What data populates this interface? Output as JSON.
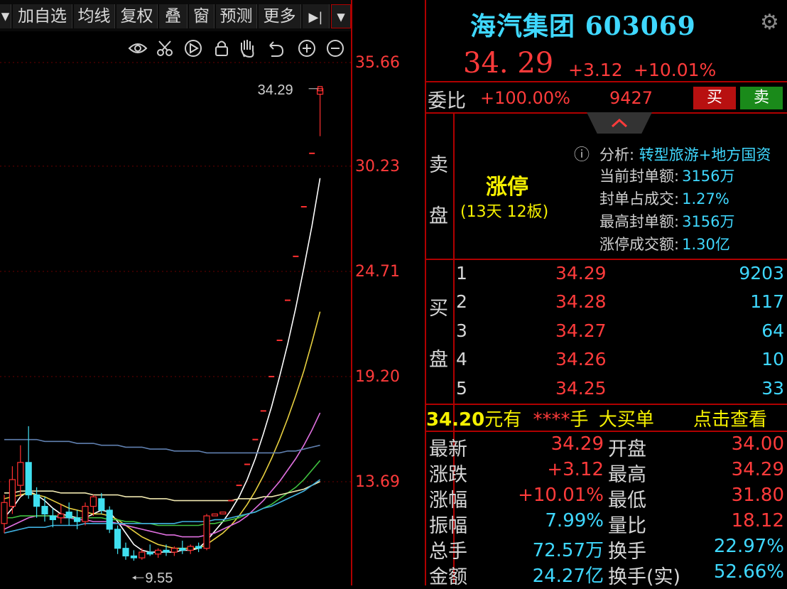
{
  "toolbar": {
    "items": [
      "加自选",
      "均线",
      "复权",
      "叠",
      "窗",
      "预测",
      "更多"
    ],
    "dropdown_arrow": "▾",
    "play_icon": "▶|"
  },
  "chart_tools": [
    "eye-icon",
    "scissors-icon",
    "play-icon",
    "lock-icon",
    "hand-icon",
    "undo-icon",
    "zoom-in-icon",
    "zoom-out-icon"
  ],
  "chart_data": {
    "type": "candlestick",
    "y_ticks": [
      "35.66",
      "30.23",
      "24.71",
      "19.20",
      "13.69"
    ],
    "ylim": [
      9.0,
      37.0
    ],
    "last_price_label": "34.29",
    "low_marker_label": "9.55",
    "candles": [
      {
        "o": 11.5,
        "h": 13.0,
        "l": 11.0,
        "c": 12.6
      },
      {
        "o": 12.4,
        "h": 14.5,
        "l": 12.0,
        "c": 13.8
      },
      {
        "o": 13.5,
        "h": 15.6,
        "l": 12.9,
        "c": 14.7
      },
      {
        "o": 14.7,
        "h": 16.6,
        "l": 12.8,
        "c": 13.0
      },
      {
        "o": 13.0,
        "h": 13.4,
        "l": 11.8,
        "c": 12.4
      },
      {
        "o": 12.4,
        "h": 12.9,
        "l": 11.6,
        "c": 12.0
      },
      {
        "o": 11.9,
        "h": 12.3,
        "l": 11.3,
        "c": 11.7
      },
      {
        "o": 11.8,
        "h": 12.5,
        "l": 11.5,
        "c": 12.0
      },
      {
        "o": 12.1,
        "h": 12.6,
        "l": 11.4,
        "c": 11.8
      },
      {
        "o": 11.8,
        "h": 12.2,
        "l": 11.2,
        "c": 11.6
      },
      {
        "o": 11.6,
        "h": 12.6,
        "l": 11.4,
        "c": 12.4
      },
      {
        "o": 12.4,
        "h": 13.0,
        "l": 11.9,
        "c": 12.9
      },
      {
        "o": 12.8,
        "h": 13.1,
        "l": 12.0,
        "c": 12.2
      },
      {
        "o": 12.2,
        "h": 12.4,
        "l": 11.0,
        "c": 11.2
      },
      {
        "o": 11.2,
        "h": 11.4,
        "l": 9.9,
        "c": 10.2
      },
      {
        "o": 10.2,
        "h": 10.5,
        "l": 9.6,
        "c": 9.8
      },
      {
        "o": 9.8,
        "h": 10.1,
        "l": 9.55,
        "c": 9.7
      },
      {
        "o": 9.7,
        "h": 10.2,
        "l": 9.6,
        "c": 10.0
      },
      {
        "o": 10.0,
        "h": 10.4,
        "l": 9.8,
        "c": 9.9
      },
      {
        "o": 9.9,
        "h": 10.2,
        "l": 9.7,
        "c": 10.1
      },
      {
        "o": 10.1,
        "h": 10.4,
        "l": 9.8,
        "c": 10.0
      },
      {
        "o": 10.0,
        "h": 10.3,
        "l": 9.8,
        "c": 10.2
      },
      {
        "o": 10.2,
        "h": 10.6,
        "l": 9.9,
        "c": 10.1
      },
      {
        "o": 10.1,
        "h": 10.4,
        "l": 9.9,
        "c": 10.3
      },
      {
        "o": 10.3,
        "h": 10.5,
        "l": 10.0,
        "c": 10.2
      },
      {
        "o": 10.2,
        "h": 12.0,
        "l": 10.1,
        "c": 11.9
      },
      {
        "o": 11.9,
        "h": 12.0,
        "l": 11.9,
        "c": 12.0
      },
      {
        "o": 12.0,
        "h": 12.1,
        "l": 12.0,
        "c": 12.1
      },
      {
        "o": 12.7,
        "h": 12.7,
        "l": 12.7,
        "c": 12.7
      },
      {
        "o": 13.5,
        "h": 13.5,
        "l": 13.5,
        "c": 13.5
      },
      {
        "o": 14.6,
        "h": 14.6,
        "l": 14.6,
        "c": 14.6
      },
      {
        "o": 15.9,
        "h": 15.9,
        "l": 15.9,
        "c": 15.9
      },
      {
        "o": 17.4,
        "h": 17.4,
        "l": 17.4,
        "c": 17.4
      },
      {
        "o": 19.2,
        "h": 19.2,
        "l": 19.2,
        "c": 19.2
      },
      {
        "o": 21.1,
        "h": 21.1,
        "l": 21.1,
        "c": 21.1
      },
      {
        "o": 23.2,
        "h": 23.2,
        "l": 23.2,
        "c": 23.2
      },
      {
        "o": 25.5,
        "h": 25.5,
        "l": 25.5,
        "c": 25.5
      },
      {
        "o": 28.1,
        "h": 28.1,
        "l": 28.1,
        "c": 28.1
      },
      {
        "o": 30.9,
        "h": 30.9,
        "l": 30.9,
        "c": 30.9
      },
      {
        "o": 34.0,
        "h": 34.29,
        "l": 31.8,
        "c": 34.29
      }
    ],
    "ma_lines": [
      {
        "name": "white",
        "color": "#ffffff",
        "values": [
          11.8,
          12.3,
          12.9,
          13.2,
          13.0,
          12.7,
          12.3,
          12.0,
          11.9,
          11.8,
          11.8,
          12.0,
          12.2,
          12.1,
          11.6,
          11.0,
          10.4,
          10.1,
          10.0,
          10.0,
          10.0,
          10.0,
          10.1,
          10.1,
          10.2,
          10.6,
          11.1,
          11.6,
          12.2,
          12.9,
          13.8,
          14.9,
          16.2,
          17.6,
          19.2,
          20.9,
          22.8,
          24.9,
          27.1,
          29.6
        ]
      },
      {
        "name": "yellow",
        "color": "#e8d040",
        "values": [
          12.8,
          12.9,
          13.0,
          13.1,
          13.0,
          12.9,
          12.7,
          12.5,
          12.3,
          12.2,
          12.1,
          12.0,
          12.0,
          11.9,
          11.7,
          11.4,
          11.1,
          10.8,
          10.6,
          10.4,
          10.3,
          10.2,
          10.2,
          10.2,
          10.2,
          10.4,
          10.7,
          11.0,
          11.4,
          11.9,
          12.5,
          13.2,
          14.0,
          14.9,
          15.9,
          17.0,
          18.2,
          19.5,
          21.0,
          22.6
        ]
      },
      {
        "name": "magenta",
        "color": "#e070e0",
        "values": [
          11.2,
          11.4,
          11.6,
          11.8,
          11.9,
          11.9,
          11.9,
          11.8,
          11.8,
          11.7,
          11.7,
          11.6,
          11.6,
          11.6,
          11.5,
          11.4,
          11.3,
          11.2,
          11.1,
          11.0,
          10.9,
          10.9,
          10.8,
          10.8,
          10.8,
          10.9,
          11.0,
          11.2,
          11.4,
          11.6,
          11.9,
          12.3,
          12.7,
          13.2,
          13.7,
          14.3,
          14.9,
          15.6,
          16.4,
          17.3
        ]
      },
      {
        "name": "green",
        "color": "#40c040",
        "values": [
          11.8,
          11.8,
          11.9,
          11.9,
          11.9,
          11.9,
          11.9,
          11.9,
          11.8,
          11.8,
          11.8,
          11.8,
          11.8,
          11.7,
          11.7,
          11.6,
          11.6,
          11.5,
          11.5,
          11.4,
          11.4,
          11.4,
          11.4,
          11.4,
          11.4,
          11.5,
          11.5,
          11.6,
          11.7,
          11.8,
          12.0,
          12.1,
          12.3,
          12.5,
          12.8,
          13.1,
          13.4,
          13.8,
          14.3,
          14.8
        ]
      },
      {
        "name": "cream",
        "color": "#f0e8b0",
        "values": [
          13.1,
          13.1,
          13.2,
          13.2,
          13.2,
          13.2,
          13.2,
          13.1,
          13.1,
          13.1,
          13.1,
          13.0,
          13.0,
          13.0,
          13.0,
          12.9,
          12.9,
          12.9,
          12.8,
          12.8,
          12.8,
          12.7,
          12.7,
          12.7,
          12.7,
          12.7,
          12.7,
          12.7,
          12.7,
          12.8,
          12.8,
          12.8,
          12.9,
          12.9,
          13.0,
          13.1,
          13.2,
          13.3,
          13.5,
          13.7
        ]
      },
      {
        "name": "steelblue",
        "color": "#6080b0",
        "values": [
          15.9,
          15.9,
          15.9,
          15.9,
          15.9,
          15.8,
          15.8,
          15.8,
          15.8,
          15.7,
          15.7,
          15.7,
          15.6,
          15.6,
          15.6,
          15.5,
          15.5,
          15.5,
          15.4,
          15.4,
          15.4,
          15.3,
          15.3,
          15.3,
          15.3,
          15.2,
          15.2,
          15.2,
          15.2,
          15.2,
          15.2,
          15.2,
          15.2,
          15.2,
          15.2,
          15.3,
          15.3,
          15.4,
          15.5,
          15.6
        ]
      },
      {
        "name": "lightblue",
        "color": "#40b0e0",
        "values": [
          11.0,
          11.1,
          11.2,
          11.3,
          11.3,
          11.3,
          11.4,
          11.4,
          11.4,
          11.4,
          11.5,
          11.5,
          11.5,
          11.5,
          11.5,
          11.5,
          11.5,
          11.5,
          11.5,
          11.5,
          11.5,
          11.5,
          11.6,
          11.6,
          11.6,
          11.6,
          11.7,
          11.7,
          11.8,
          11.9,
          12.0,
          12.1,
          12.3,
          12.4,
          12.6,
          12.8,
          13.0,
          13.2,
          13.5,
          13.8
        ]
      }
    ]
  },
  "stock": {
    "name": "海汽集团",
    "code": "603069",
    "price": "34. 29",
    "change": "+3.12",
    "change_pct": "+10.01%",
    "settings_icon": "⚙"
  },
  "weibi": {
    "label": "委比",
    "pct": "+100.00%",
    "value": "9427",
    "buy_btn": "买",
    "sell_btn": "卖"
  },
  "sell_side": {
    "label_top": "卖",
    "label_bottom": "盘",
    "chevron": "⌃",
    "status": "涨停",
    "status_sub": "(13天 12板)",
    "info_icon": "ⓘ",
    "analysis_label": "分析:",
    "analysis_text": "转型旅游+地方国资",
    "lines": [
      {
        "k": "当前封单额:",
        "v": "3156万"
      },
      {
        "k": "封单占成交:",
        "v": "1.27%"
      },
      {
        "k": "最高封单额:",
        "v": "3156万"
      },
      {
        "k": "涨停成交额:",
        "v": "1.30亿"
      }
    ]
  },
  "buy_side": {
    "label_top": "买",
    "label_bottom": "盘",
    "rows": [
      {
        "n": "1",
        "p": "34.29",
        "v": "9203"
      },
      {
        "n": "2",
        "p": "34.28",
        "v": "117"
      },
      {
        "n": "3",
        "p": "34.27",
        "v": "64"
      },
      {
        "n": "4",
        "p": "34.26",
        "v": "10"
      },
      {
        "n": "5",
        "p": "34.25",
        "v": "33"
      }
    ]
  },
  "big_order": {
    "price": "34.20",
    "t1": "元有",
    "stars": "****",
    "t2": "手",
    "t3": "大买单",
    "link": "点击查看"
  },
  "stats": [
    {
      "k1": "最新",
      "v1": "34.29",
      "k2": "开盘",
      "v2": "34.00",
      "c1": "red",
      "c2": "red"
    },
    {
      "k1": "涨跌",
      "v1": "+3.12",
      "k2": "最高",
      "v2": "34.29",
      "c1": "red",
      "c2": "red"
    },
    {
      "k1": "涨幅",
      "v1": "+10.01%",
      "k2": "最低",
      "v2": "31.80",
      "c1": "red",
      "c2": "red"
    },
    {
      "k1": "振幅",
      "v1": "7.99%",
      "k2": "量比",
      "v2": "18.12",
      "c1": "cyan",
      "c2": "red"
    },
    {
      "k1": "总手",
      "v1": "72.57万",
      "k2": "换手",
      "v2": "22.97%",
      "c1": "cyan",
      "c2": "cyan"
    },
    {
      "k1": "金额",
      "v1": "24.27亿",
      "k2": "换手(实)",
      "v2": "52.66%",
      "c1": "cyan",
      "c2": "cyan"
    }
  ]
}
